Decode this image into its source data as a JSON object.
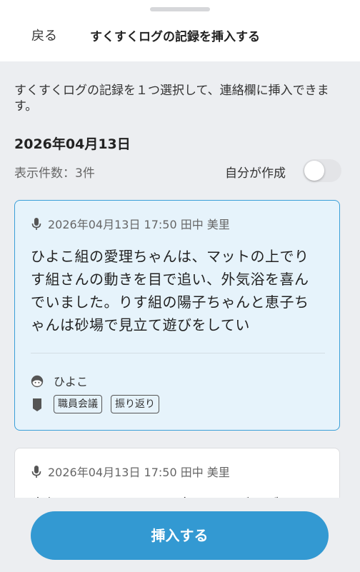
{
  "header": {
    "back_label": "戻る",
    "title": "すくすくログの記録を挿入する"
  },
  "instruction": "すくすくログの記録を１つ選択して、連絡欄に挿入できます。",
  "date_heading": "2026年04月13日",
  "filter": {
    "count_label": "表示件数：3件",
    "own_label": "自分が作成",
    "own_toggle_on": false
  },
  "records": [
    {
      "meta": "2026年04月13日 17:50 田中 美里",
      "text": "ひよこ組の愛理ちゃんは、マットの上でりす組さんの動きを目で追い、外気浴を喜んでいました。りす組の陽子ちゃんと恵子ちゃんは砂場で見立て遊びをしてい",
      "class_name": "ひよこ",
      "tags": [
        "職員会議",
        "振り返り"
      ],
      "selected": true
    },
    {
      "meta": "2026年04月13日 17:50 田中 美里",
      "text": "太郎くんと早くん、園庭の隅でダンゴム",
      "selected": false
    }
  ],
  "footer": {
    "insert_label": "挿入する"
  },
  "colors": {
    "accent": "#3399d2",
    "selected_card_bg": "#e6f3fb",
    "selected_card_border": "#3a9fd8"
  }
}
